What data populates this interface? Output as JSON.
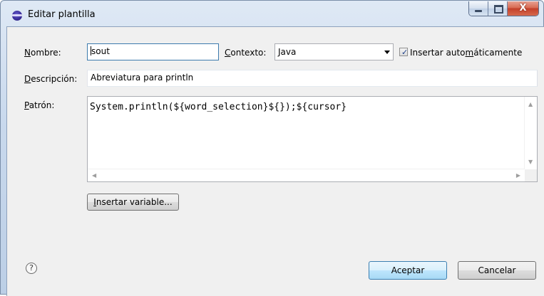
{
  "window": {
    "title": "Editar plantilla",
    "close_glyph": "X"
  },
  "form": {
    "name_label_u": "N",
    "name_label_rest": "ombre:",
    "name_value": "sout",
    "context_label_u": "C",
    "context_label_rest": "ontexto:",
    "context_value": "Java",
    "auto_insert_checked": true,
    "auto_insert_label_a": "Insertar auto",
    "auto_insert_label_u": "m",
    "auto_insert_label_b": "áticamente",
    "description_label_u": "D",
    "description_label_rest": "escripción:",
    "description_value": "Abreviatura para println",
    "pattern_label_u": "P",
    "pattern_label_rest": "atrón:",
    "pattern_value": "System.println(${word_selection}${});${cursor}",
    "insert_variable_u": "I",
    "insert_variable_rest": "nsertar variable..."
  },
  "buttons": {
    "accept": "Aceptar",
    "cancel": "Cancelar",
    "help": "?"
  },
  "icons": {
    "window": "eclipse-icon",
    "minimize": "minimize-icon",
    "maximize": "maximize-icon",
    "close": "close-icon",
    "help": "help-icon"
  }
}
